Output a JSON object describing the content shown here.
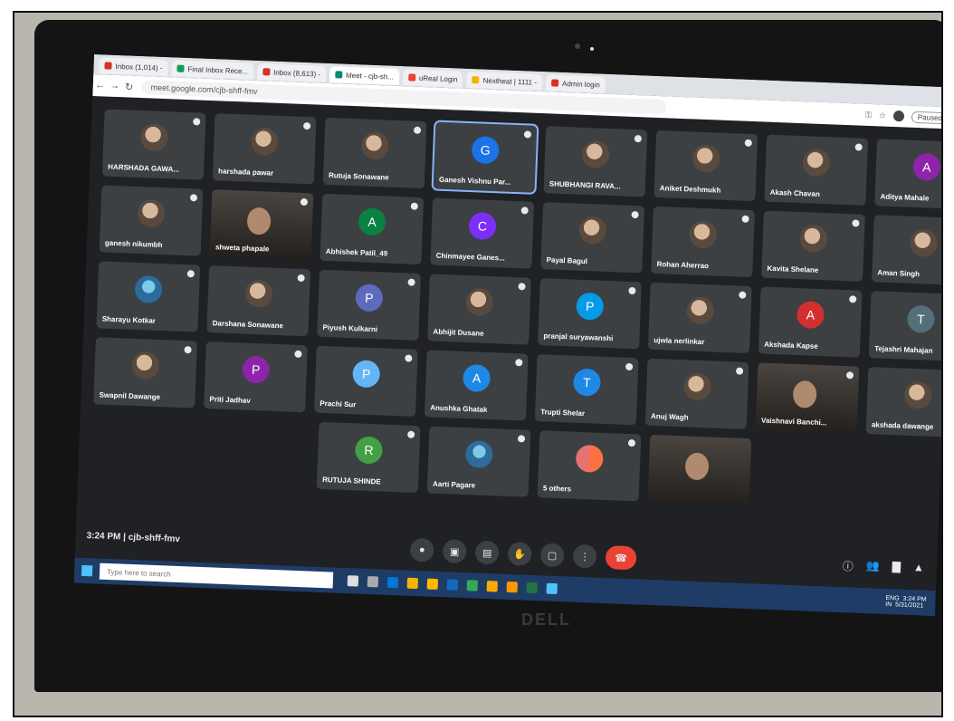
{
  "browser": {
    "tabs": [
      {
        "label": "Inbox (1,014) -",
        "color": "#d93025"
      },
      {
        "label": "Final Inbox Rece...",
        "color": "#0f9d58"
      },
      {
        "label": "Inbox (8,613) -",
        "color": "#d93025"
      },
      {
        "label": "Meet - cjb-sh...",
        "color": "#00897b",
        "active": true
      },
      {
        "label": "uReal Login",
        "color": "#ea4335"
      },
      {
        "label": "Nextheat | 1111 -",
        "color": "#f4b400"
      },
      {
        "label": "Admin login",
        "color": "#d93025"
      }
    ],
    "url": "meet.google.com/cjb-shff-fmv",
    "ext_label": "Paused"
  },
  "participants": [
    {
      "name": "HARSHADA GAWA...",
      "kind": "photo"
    },
    {
      "name": "harshada pawar",
      "kind": "photo"
    },
    {
      "name": "Rutuja Sonawane",
      "kind": "photo"
    },
    {
      "name": "Ganesh Vishnu Par...",
      "kind": "letter",
      "letter": "G",
      "color": "#1a73e8",
      "active": true
    },
    {
      "name": "SHUBHANGI RAVA...",
      "kind": "photo"
    },
    {
      "name": "Aniket Deshmukh",
      "kind": "photo"
    },
    {
      "name": "Akash Chavan",
      "kind": "photo"
    },
    {
      "name": "Aditya Mahale",
      "kind": "letter",
      "letter": "A",
      "color": "#8e24aa"
    },
    {
      "name": "ganesh nikumbh",
      "kind": "photo"
    },
    {
      "name": "shweta phapale",
      "kind": "cam"
    },
    {
      "name": "Abhishek Patil_49",
      "kind": "letter",
      "letter": "A",
      "color": "#0b8043"
    },
    {
      "name": "Chinmayee Ganes...",
      "kind": "letter",
      "letter": "C",
      "color": "#7b2ff7"
    },
    {
      "name": "Payal Bagul",
      "kind": "photo"
    },
    {
      "name": "Rohan Aherrao",
      "kind": "photo"
    },
    {
      "name": "Kavita Shelane",
      "kind": "photo"
    },
    {
      "name": "Aman Singh",
      "kind": "photo"
    },
    {
      "name": "Sharayu Kotkar",
      "kind": "photo2"
    },
    {
      "name": "Darshana Sonawane",
      "kind": "photo"
    },
    {
      "name": "Piyush Kulkarni",
      "kind": "letter",
      "letter": "P",
      "color": "#5c6bc0"
    },
    {
      "name": "Abhijit Dusane",
      "kind": "photo"
    },
    {
      "name": "pranjal suryawanshi",
      "kind": "letter",
      "letter": "P",
      "color": "#039be5"
    },
    {
      "name": "ujwla nerlinkar",
      "kind": "photo"
    },
    {
      "name": "Akshada Kapse",
      "kind": "letter",
      "letter": "A",
      "color": "#d32f2f"
    },
    {
      "name": "Tejashri Mahajan",
      "kind": "letter",
      "letter": "T",
      "color": "#546e7a"
    },
    {
      "name": "Swapnil Dawange",
      "kind": "photo"
    },
    {
      "name": "Priti Jadhav",
      "kind": "letter",
      "letter": "P",
      "color": "#8e24aa"
    },
    {
      "name": "Prachi Sur",
      "kind": "letter",
      "letter": "P",
      "color": "#64b5f6"
    },
    {
      "name": "Anushka Ghatak",
      "kind": "letter",
      "letter": "A",
      "color": "#1e88e5"
    },
    {
      "name": "Trupti Shelar",
      "kind": "letter",
      "letter": "T",
      "color": "#1e88e5"
    },
    {
      "name": "Anuj Wagh",
      "kind": "photo"
    },
    {
      "name": "Vaishnavi Banchi...",
      "kind": "cam"
    },
    {
      "name": "akshada dawange",
      "kind": "photo"
    },
    {
      "name": "RUTUJA SHINDE",
      "kind": "letter",
      "letter": "R",
      "color": "#43a047"
    },
    {
      "name": "Aarti Pagare",
      "kind": "photo2"
    },
    {
      "name": "5 others",
      "kind": "others"
    },
    {
      "name": "",
      "kind": "cam"
    }
  ],
  "meeting": {
    "time_code": "3:24 PM  |  cjb-shff-fmv"
  },
  "taskbar": {
    "search_placeholder": "Type here to search",
    "tray": "ENG  3:24 PM\nIN  5/31/2021"
  },
  "brand": "DELL"
}
